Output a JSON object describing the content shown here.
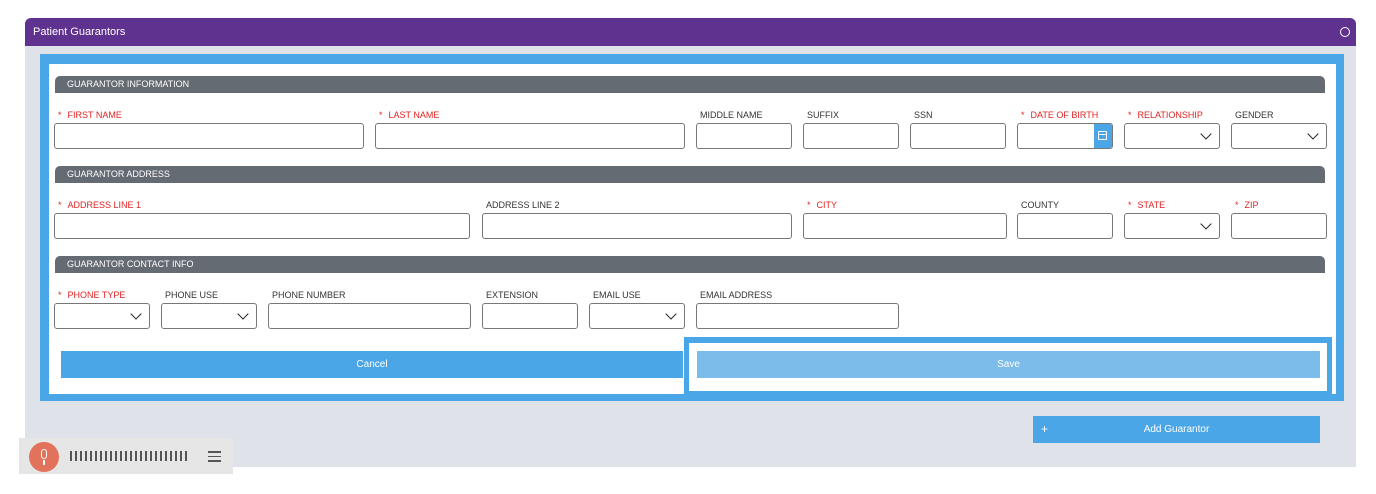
{
  "panel": {
    "title": "Patient Guarantors"
  },
  "sections": {
    "info": "GUARANTOR INFORMATION",
    "address": "GUARANTOR ADDRESS",
    "contact": "GUARANTOR CONTACT INFO"
  },
  "fields": {
    "first_name": "FIRST NAME",
    "last_name": "LAST NAME",
    "middle_name": "MIDDLE NAME",
    "suffix": "SUFFIX",
    "ssn": "SSN",
    "date_of_birth": "DATE OF BIRTH",
    "relationship": "RELATIONSHIP",
    "gender": "GENDER",
    "address_line_1": "ADDRESS LINE 1",
    "address_line_2": "ADDRESS LINE 2",
    "city": "CITY",
    "county": "COUNTY",
    "state": "STATE",
    "zip": "ZIP",
    "phone_type": "PHONE TYPE",
    "phone_use": "PHONE USE",
    "phone_number": "PHONE NUMBER",
    "extension": "EXTENSION",
    "email_use": "EMAIL USE",
    "email_address": "EMAIL ADDRESS"
  },
  "buttons": {
    "cancel": "Cancel",
    "save": "Save",
    "add_guarantor": "Add Guarantor",
    "add_icon": "+"
  },
  "colors": {
    "header_purple": "#5f3290",
    "accent_blue": "#4aa6e6",
    "section_gray": "#646b72",
    "required_red": "#e02424",
    "mic_orange": "#e2725b"
  }
}
